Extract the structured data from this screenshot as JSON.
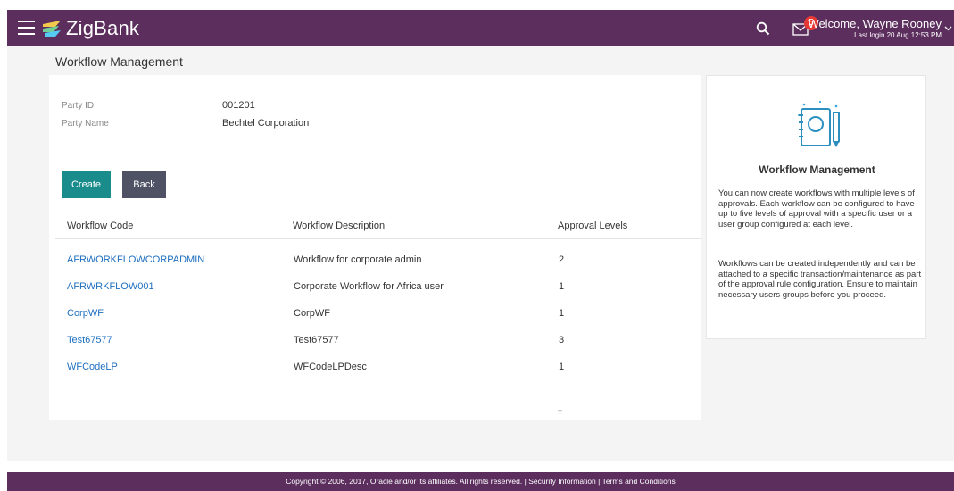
{
  "header": {
    "app_name": "ZigBank",
    "welcome_text": "Welcome, Wayne Rooney",
    "last_login": "Last login 20 Aug 12:53 PM",
    "mail_count": "5",
    "brand_color": "#5c2e5e"
  },
  "page": {
    "title": "Workflow Management"
  },
  "party": {
    "id_label": "Party ID",
    "id_value": "001201",
    "name_label": "Party Name",
    "name_value": "Bechtel Corporation"
  },
  "actions": {
    "create_label": "Create",
    "back_label": "Back"
  },
  "table": {
    "headers": [
      "Workflow Code",
      "Workflow Description",
      "Approval Levels"
    ],
    "rows": [
      {
        "code": "AFRWORKFLOWCORPADMIN",
        "description": "Workflow for corporate admin",
        "levels": "2"
      },
      {
        "code": "AFRWRKFLOW001",
        "description": "Corporate Workflow for Africa user",
        "levels": "1"
      },
      {
        "code": "CorpWF",
        "description": "CorpWF",
        "levels": "1"
      },
      {
        "code": "Test67577",
        "description": "Test67577",
        "levels": "3"
      },
      {
        "code": "WFCodeLP",
        "description": "WFCodeLPDesc",
        "levels": "1"
      }
    ],
    "pager_mark": "–"
  },
  "side_panel": {
    "title": "Workflow Management",
    "paragraph1": "You can now create workflows with multiple levels of approvals. Each workflow can be configured to have up to five levels of approval with a specific user or a user group configured at each level.",
    "paragraph2": "Workflows can be created independently and can be attached to a specific transaction/maintenance as part of the approval rule configuration. Ensure to maintain necessary users groups before you proceed.",
    "icon": "notebook-pen-icon"
  },
  "footer": {
    "copyright": "Copyright © 2006, 2017, Oracle and/or its affiliates. All rights reserved.",
    "separator": " | ",
    "security_link": "Security Information",
    "terms_link": "Terms and Conditions"
  }
}
